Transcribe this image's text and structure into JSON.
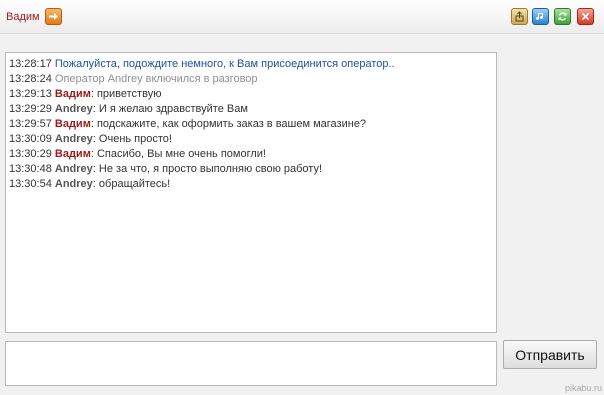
{
  "header": {
    "user_name": "Вадим"
  },
  "chat": {
    "messages": [
      {
        "time": "13:28:17",
        "author": "",
        "text": "Пожалуйста, подождите немного, к Вам присоединится оператор..",
        "kind": "system"
      },
      {
        "time": "13:28:24",
        "author": "",
        "text": "Оператор Andrey включился в разговор",
        "kind": "info"
      },
      {
        "time": "13:29:13",
        "author": "Вадим",
        "text": ": приветствую",
        "kind": "self"
      },
      {
        "time": "13:29:29",
        "author": "Andrey",
        "text": ": И я желаю здравствуйте Вам",
        "kind": "operator"
      },
      {
        "time": "13:29:57",
        "author": "Вадим",
        "text": ": подскажите, как оформить заказ в вашем магазине?",
        "kind": "self"
      },
      {
        "time": "13:30:09",
        "author": "Andrey",
        "text": ": Очень просто!",
        "kind": "operator"
      },
      {
        "time": "13:30:29",
        "author": "Вадим",
        "text": ": Спасибо, Вы мне очень помогли!",
        "kind": "self"
      },
      {
        "time": "13:30:48",
        "author": "Andrey",
        "text": ": Не за что, я просто выполняю свою работу!",
        "kind": "operator"
      },
      {
        "time": "13:30:54",
        "author": "Andrey",
        "text": ": обращайтесь!",
        "kind": "operator"
      }
    ]
  },
  "composer": {
    "input_value": "",
    "send_label": "Отправить"
  },
  "watermark": "pikabu.ru",
  "icons": {
    "user_button": "arrow-right-icon",
    "toolbar": [
      "save-icon",
      "sound-icon",
      "refresh-icon",
      "close-icon"
    ]
  },
  "colors": {
    "self_nick": "#9b1c1c",
    "operator_nick": "#555555",
    "system_text": "#2250a0",
    "info_text": "#909090"
  }
}
